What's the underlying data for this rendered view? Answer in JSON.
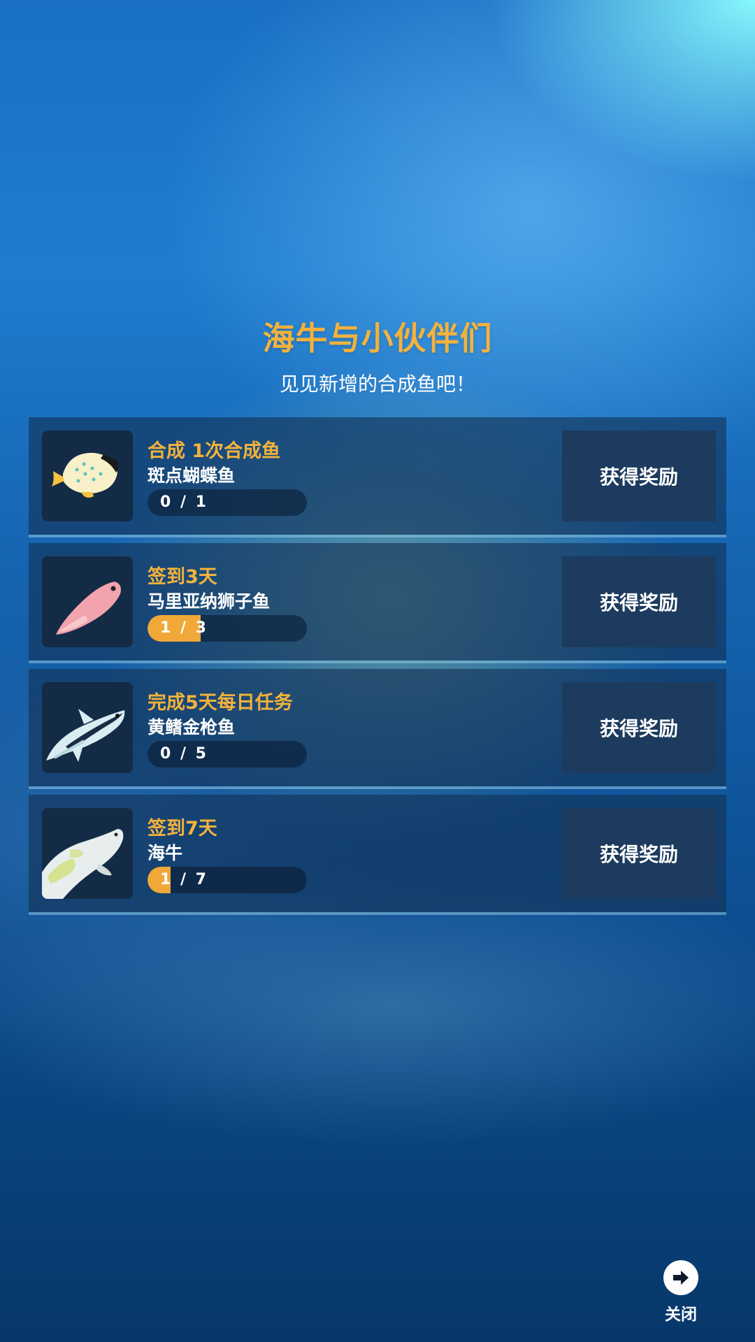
{
  "header": {
    "title": "海牛与小伙伴们",
    "subtitle": "见见新增的合成鱼吧！"
  },
  "tasks": [
    {
      "title": "合成 1次合成鱼",
      "fish": "斑点蝴蝶鱼",
      "progress_text": "0 / 1",
      "progress": 0,
      "icon": "butterflyfish-icon",
      "button": "获得奖励"
    },
    {
      "title": "签到3天",
      "fish": "马里亚纳狮子鱼",
      "progress_text": "1 / 3",
      "progress": 0.333,
      "icon": "lionfish-icon",
      "button": "获得奖励"
    },
    {
      "title": "完成5天每日任务",
      "fish": "黄鳍金枪鱼",
      "progress_text": "0 / 5",
      "progress": 0,
      "icon": "tuna-icon",
      "button": "获得奖励"
    },
    {
      "title": "签到7天",
      "fish": "海牛",
      "progress_text": "1 / 7",
      "progress": 0.143,
      "icon": "manatee-icon",
      "button": "获得奖励"
    }
  ],
  "close": {
    "label": "关闭",
    "icon": "arrow-right-icon"
  },
  "colors": {
    "accent": "#f3b23c",
    "progress_fill": "#f0a838",
    "button_bg": "#1c3b5e"
  }
}
